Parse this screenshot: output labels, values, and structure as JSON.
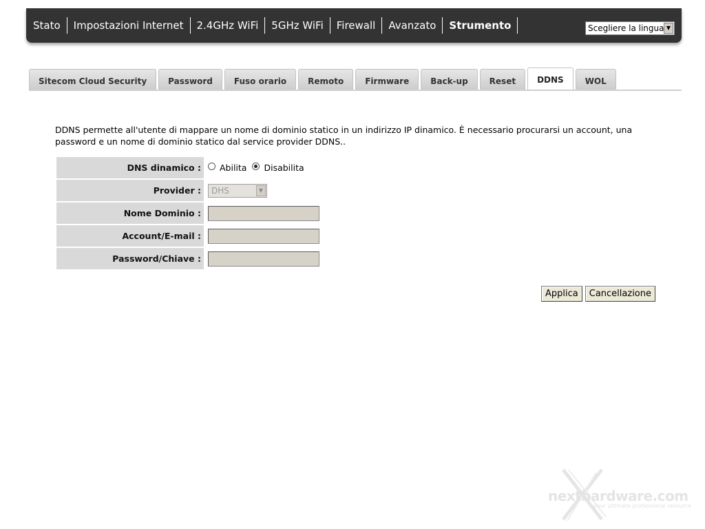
{
  "topnav": {
    "items": [
      {
        "label": "Stato",
        "active": false
      },
      {
        "label": "Impostazioni Internet",
        "active": false
      },
      {
        "label": "2.4GHz WiFi",
        "active": false
      },
      {
        "label": "5GHz WiFi",
        "active": false
      },
      {
        "label": "Firewall",
        "active": false
      },
      {
        "label": "Avanzato",
        "active": false
      },
      {
        "label": "Strumento",
        "active": true
      }
    ],
    "language_select": {
      "value": "Scegliere la lingua"
    }
  },
  "tabs": [
    {
      "label": "Sitecom Cloud Security",
      "active": false
    },
    {
      "label": "Password",
      "active": false
    },
    {
      "label": "Fuso orario",
      "active": false
    },
    {
      "label": "Remoto",
      "active": false
    },
    {
      "label": "Firmware",
      "active": false
    },
    {
      "label": "Back-up",
      "active": false
    },
    {
      "label": "Reset",
      "active": false
    },
    {
      "label": "DDNS",
      "active": true
    },
    {
      "label": "WOL",
      "active": false
    }
  ],
  "description": "DDNS permette all'utente di mappare un nome di dominio statico in un indirizzo IP dinamico. È necessario procurarsi un account, una password e un nome di dominio statico dal service provider DDNS..",
  "form": {
    "dns_dynamic": {
      "label": "DNS dinamico :",
      "options": [
        {
          "label": "Abilita",
          "checked": false
        },
        {
          "label": "Disabilita",
          "checked": true
        }
      ]
    },
    "provider": {
      "label": "Provider :",
      "value": "DHS"
    },
    "domain_name": {
      "label": "Nome Dominio :",
      "value": ""
    },
    "account": {
      "label": "Account/E-mail :",
      "value": ""
    },
    "password": {
      "label": "Password/Chiave :",
      "value": ""
    }
  },
  "buttons": {
    "apply": "Applica",
    "cancel": "Cancellazione"
  },
  "watermark": {
    "text": "nexthardware.com",
    "tagline": "your ultimate professional resource"
  }
}
